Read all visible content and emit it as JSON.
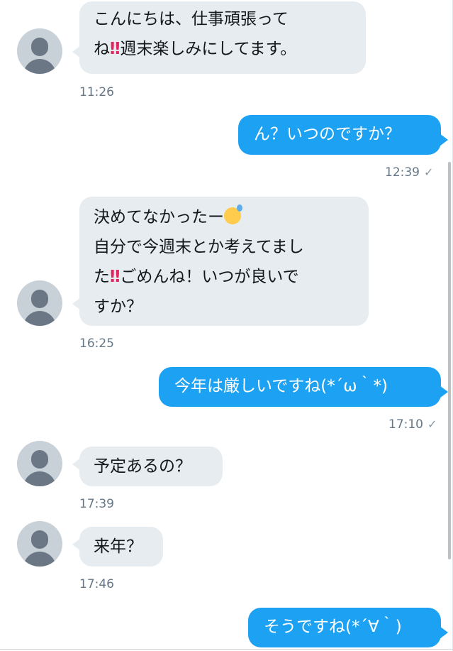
{
  "conversation": {
    "messages": [
      {
        "direction": "in",
        "lines": [
          "こんにちは、仕事頑張って",
          "ね‼️週末楽しみにしてます。"
        ],
        "time": "11:26"
      },
      {
        "direction": "out",
        "lines": [
          "ん？いつのですか？"
        ],
        "time": "12:39",
        "read_mark": "✓"
      },
      {
        "direction": "in",
        "lines": [
          "決めてなかったー😅",
          "自分で今週末とか考えてまし",
          "た‼️ごめんね！いつが良いで",
          "すか？"
        ],
        "time": "16:25"
      },
      {
        "direction": "out",
        "lines": [
          "今年は厳しいですね(*´ω｀*)"
        ],
        "time": "17:10",
        "read_mark": "✓"
      },
      {
        "direction": "in",
        "lines": [
          "予定あるの？"
        ],
        "time": "17:39"
      },
      {
        "direction": "in",
        "lines": [
          "来年？"
        ],
        "time": "17:46"
      },
      {
        "direction": "out",
        "lines": [
          "そうですね(*´∀｀)"
        ],
        "time": ""
      }
    ]
  },
  "colors": {
    "incoming_bubble": "#e6ecf0",
    "outgoing_bubble": "#1da1f2",
    "timestamp": "#657786",
    "avatar_bg": "#c8d0d8",
    "avatar_fg": "#6b7785"
  },
  "icons": {
    "avatar": "default-profile-icon",
    "read_receipt": "checkmark-icon"
  }
}
